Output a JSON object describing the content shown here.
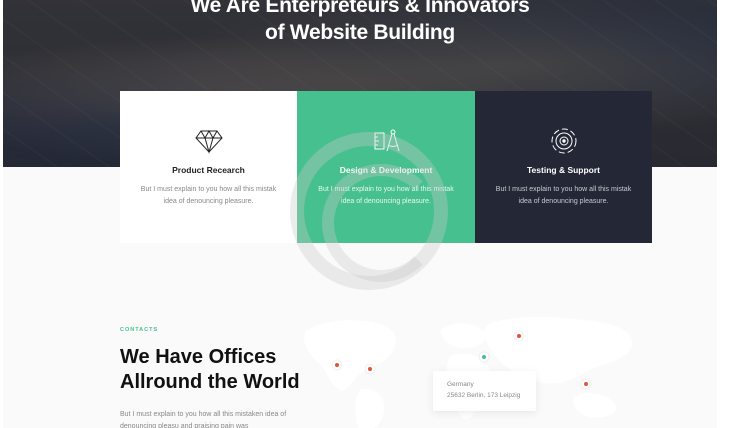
{
  "hero": {
    "title_line1": "We Are Enterpreteurs & Innovators",
    "title_line2": "of Website Building"
  },
  "services": [
    {
      "icon": "diamond-icon",
      "title": "Product Recearch",
      "text": "But I must explain to you how all this mistak idea of denouncing pleasure."
    },
    {
      "icon": "compass-ruler-icon",
      "title": "Design & Development",
      "text": "But I must explain to you how all this mistak idea of denouncing pleasure."
    },
    {
      "icon": "target-icon",
      "title": "Testing & Support",
      "text": "But I must explain to you how all this mistak idea of denouncing pleasure."
    }
  ],
  "contacts": {
    "label": "CONTACTS",
    "title_line1": "We Have Offices",
    "title_line2": "Allround the World",
    "text": "But I must explain to you how all this mistaken idea of denouncing pleasu and praising pain was"
  },
  "map_popup": {
    "country": "Germany",
    "address": "25632 Berlin, 173 Leipzig"
  },
  "colors": {
    "accent_green": "#47c08f",
    "dark_card": "#242736",
    "pin_red": "#e5533d"
  }
}
